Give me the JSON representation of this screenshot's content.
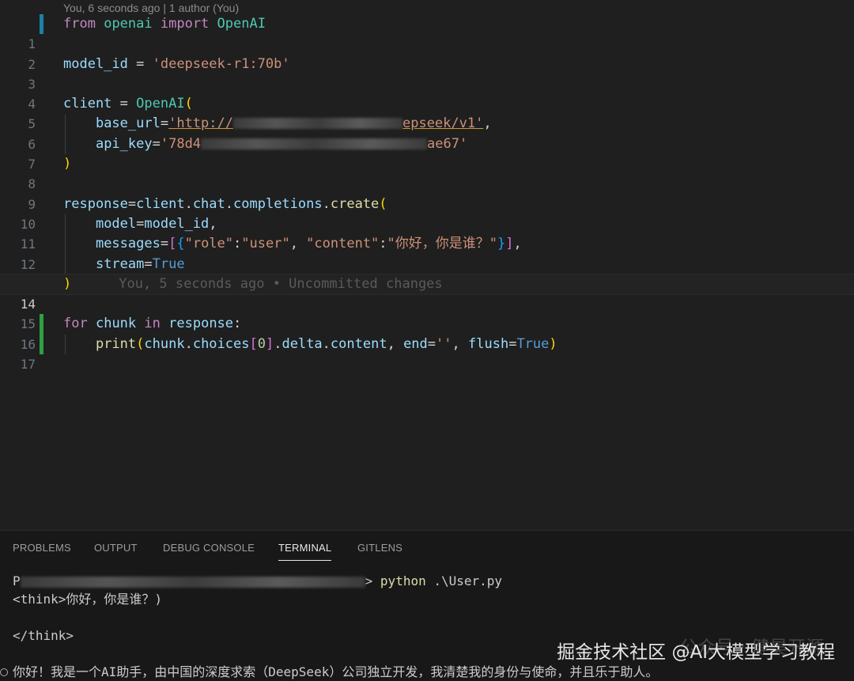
{
  "editor": {
    "codelens": "You, 6 seconds ago | 1 author (You)",
    "lines": [
      {
        "n": "1"
      },
      {
        "n": "2"
      },
      {
        "n": "3"
      },
      {
        "n": "4"
      },
      {
        "n": "5"
      },
      {
        "n": "6"
      },
      {
        "n": "7"
      },
      {
        "n": "8"
      },
      {
        "n": "9"
      },
      {
        "n": "10"
      },
      {
        "n": "11"
      },
      {
        "n": "12"
      },
      {
        "n": "13"
      },
      {
        "n": "14"
      },
      {
        "n": "15"
      },
      {
        "n": "16"
      },
      {
        "n": "17"
      }
    ],
    "code": {
      "l1": {
        "from": "from",
        "mod": "openai",
        "imp": "import",
        "cls": "OpenAI"
      },
      "l3": {
        "var": "model_id",
        "eq": " = ",
        "str": "'deepseek-r1:70b'"
      },
      "l5": {
        "var": "client",
        "eq": " = ",
        "cls": "OpenAI",
        "paren": "("
      },
      "l6": {
        "arg": "base_url",
        "eq": "=",
        "str_a": "'http://",
        "str_b": "epseek/v1'",
        "comma": ","
      },
      "l7": {
        "arg": "api_key",
        "eq": "=",
        "str_a": "'78d4",
        "str_b": "ae67'"
      },
      "l8": {
        "paren": ")"
      },
      "l10": {
        "var": "response",
        "eq": "=",
        "obj": "client",
        "d1": ".",
        "a1": "chat",
        "d2": ".",
        "a2": "completions",
        "d3": ".",
        "fn": "create",
        "paren": "("
      },
      "l11": {
        "arg": "model",
        "eq": "=",
        "val": "model_id",
        "comma": ","
      },
      "l12": {
        "arg": "messages",
        "eq": "=",
        "b1": "[",
        "b2": "{",
        "k1": "\"role\"",
        "c1": ":",
        "v1": "\"user\"",
        "sep": ", ",
        "k2": "\"content\"",
        "c2": ":",
        "v2": "\"你好，你是谁？\"",
        "b3": "}",
        "b4": "]",
        "comma": ","
      },
      "l13": {
        "arg": "stream",
        "eq": "=",
        "val": "True"
      },
      "l14": {
        "paren": ")",
        "blame": "You, 5 seconds ago • Uncommitted changes"
      },
      "l16": {
        "kw": "for",
        "v1": "chunk",
        "kw2": "in",
        "v2": "response",
        "colon": ":"
      },
      "l17": {
        "fn": "print",
        "p": "(",
        "v": "chunk",
        "d1": ".",
        "a1": "choices",
        "b1": "[",
        "num": "0",
        "b2": "]",
        "d2": ".",
        "a2": "delta",
        "d3": ".",
        "a3": "content",
        "sep": ", ",
        "k": "end",
        "eq": "=",
        "str": "''",
        "sep2": ", ",
        "k2": "flush",
        "eq2": "=",
        "val": "True",
        "pc": ")"
      }
    }
  },
  "panel": {
    "tabs": [
      "PROBLEMS",
      "OUTPUT",
      "DEBUG CONSOLE",
      "TERMINAL",
      "GITLENS"
    ],
    "active_tab": "TERMINAL",
    "terminal": {
      "prompt_start": "P",
      "prompt_end": ">",
      "command": "python",
      "command_arg": ".\\User.py",
      "line2": "<think>你好，你是谁？)",
      "line3": "",
      "line4": "</think>",
      "line5": "",
      "line6": "你好！我是一个AI助手，由中国的深度求索（DeepSeek）公司独立开发，我清楚我的身份与使命，并且乐于助人。"
    }
  },
  "watermark": {
    "text": "掘金技术社区 @AI大模型学习教程",
    "faint_text": "公众号 · 健昊开源"
  },
  "colors": {
    "editor_bg": "#1f1f1f",
    "panel_bg": "#181818",
    "keyword": "#c586c0",
    "string": "#ce9178",
    "class": "#4ec9b0",
    "variable": "#9cdcfe",
    "function": "#dcdcaa",
    "gutter_modified": "#1b81a8",
    "gutter_added": "#2ea043"
  }
}
